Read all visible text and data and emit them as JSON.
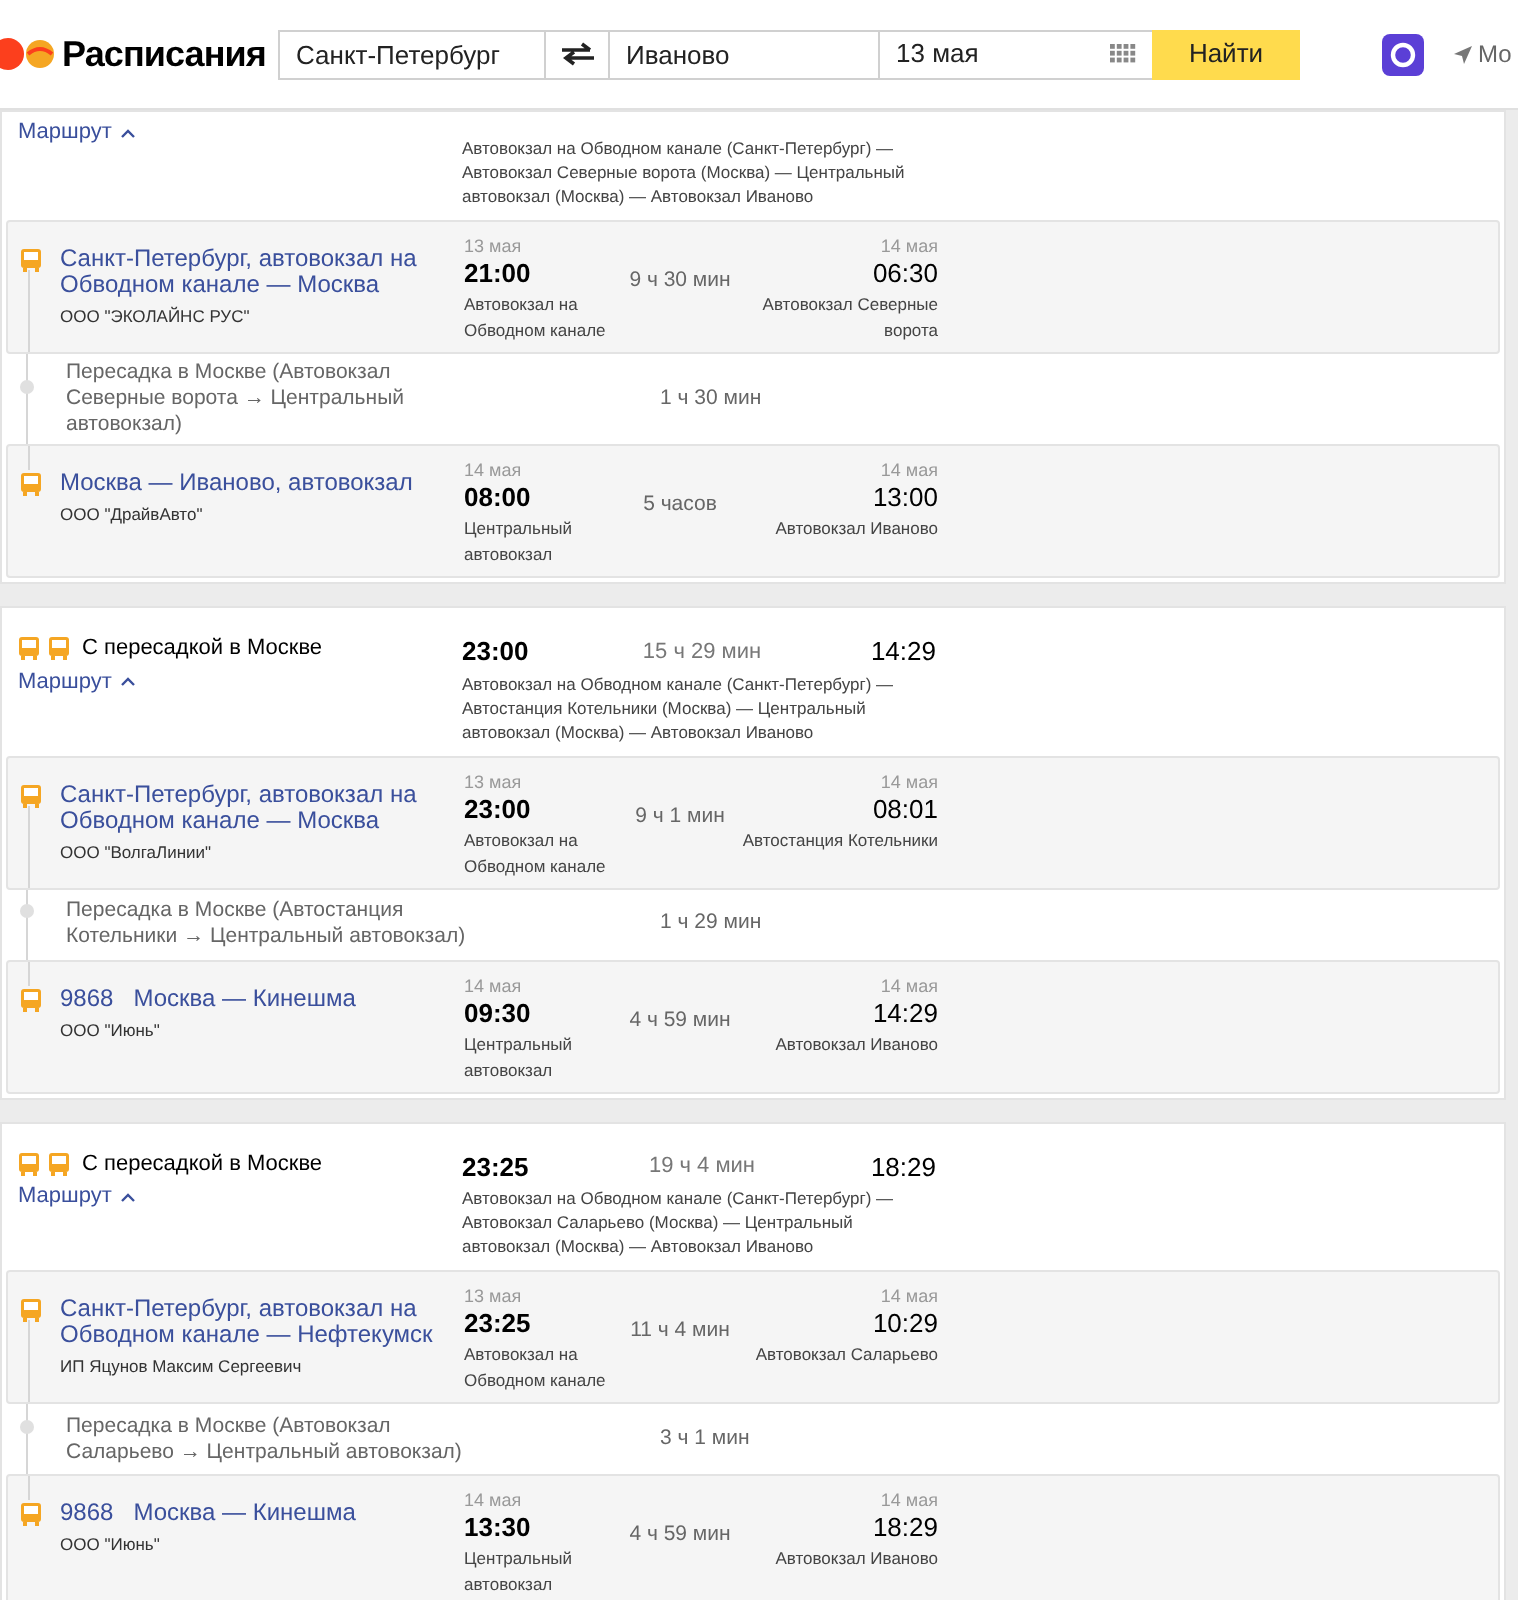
{
  "header": {
    "logo_text": "Расписания",
    "from": "Санкт-Петербург",
    "to": "Иваново",
    "date": "13 мая",
    "search_button": "Найти",
    "nav_text": "Мо"
  },
  "journeys": [
    {
      "route_link": "Маршрут",
      "expanded": true,
      "route_text": "Автовокзал на Обводном канале (Санкт-Петербург) — Автовокзал Северные ворота (Москва) — Центральный автовокзал (Москва) — Автовокзал Иваново",
      "segments": [
        {
          "kind": "trip",
          "title": "Санкт-Петербург, автовокзал на Обводном канале — Москва",
          "carrier": "ООО \"ЭКОЛАЙНС РУС\"",
          "dep_date": "13 мая",
          "dep_time": "21:00",
          "dep_station": "Автовокзал на Обводном канале",
          "duration": "9 ч 30 мин",
          "arr_date": "14 мая",
          "arr_time": "06:30",
          "arr_station": "Автовокзал Северные ворота"
        },
        {
          "kind": "transfer",
          "text": "Пересадка в Москве (Автовокзал Северные ворота → Центральный автовокзал)",
          "duration": "1 ч 30 мин"
        },
        {
          "kind": "trip",
          "title": "Москва — Иваново, автовокзал",
          "carrier": "ООО \"ДрайвАвто\"",
          "dep_date": "14 мая",
          "dep_time": "08:00",
          "dep_station": "Центральный автовокзал",
          "duration": "5 часов",
          "arr_date": "14 мая",
          "arr_time": "13:00",
          "arr_station": "Автовокзал Иваново"
        }
      ]
    },
    {
      "transports": [
        {
          "kind": "bus"
        },
        {
          "kind": "bus"
        }
      ],
      "title": "С пересадкой в Москве",
      "route_link": "Маршрут",
      "expanded": true,
      "dep_time": "23:00",
      "duration": "15 ч 29 мин",
      "arr_time": "14:29",
      "route_text": "Автовокзал на Обводном канале (Санкт-Петербург) — Автостанция Котельники (Москва) — Центральный автовокзал (Москва) — Автовокзал Иваново",
      "segments": [
        {
          "kind": "trip",
          "title": "Санкт-Петербург, автовокзал на Обводном канале — Москва",
          "carrier": "ООО \"ВолгаЛинии\"",
          "dep_date": "13 мая",
          "dep_time": "23:00",
          "dep_station": "Автовокзал на Обводном канале",
          "duration": "9 ч 1 мин",
          "arr_date": "14 мая",
          "arr_time": "08:01",
          "arr_station": "Автостанция Котельники"
        },
        {
          "kind": "transfer",
          "text": "Пересадка в Москве (Автостанция Котельники → Центральный автовокзал)",
          "duration": "1 ч 29 мин"
        },
        {
          "kind": "trip",
          "number": "9868",
          "title": "Москва — Кинешма",
          "carrier": "ООО \"Июнь\"",
          "dep_date": "14 мая",
          "dep_time": "09:30",
          "dep_station": "Центральный автовокзал",
          "duration": "4 ч 59 мин",
          "arr_date": "14 мая",
          "arr_time": "14:29",
          "arr_station": "Автовокзал Иваново"
        }
      ]
    },
    {
      "transports": [
        {
          "kind": "bus"
        },
        {
          "kind": "bus"
        }
      ],
      "title": "С пересадкой в Москве",
      "route_link": "Маршрут",
      "expanded": true,
      "dep_time": "23:25",
      "duration": "19 ч 4 мин",
      "arr_time": "18:29",
      "route_text": "Автовокзал на Обводном канале (Санкт-Петербург) — Автовокзал Саларьево (Москва) — Центральный автовокзал (Москва) — Автовокзал Иваново",
      "segments": [
        {
          "kind": "trip",
          "title": "Санкт-Петербург, автовокзал на Обводном канале — Нефтекумск",
          "carrier": "ИП Яцунов Максим Сергеевич",
          "dep_date": "13 мая",
          "dep_time": "23:25",
          "dep_station": "Автовокзал на Обводном канале",
          "duration": "11 ч 4 мин",
          "arr_date": "14 мая",
          "arr_time": "10:29",
          "arr_station": "Автовокзал Саларьево"
        },
        {
          "kind": "transfer",
          "text": "Пересадка в Москве (Автовокзал Саларьево → Центральный автовокзал)",
          "duration": "3 ч 1 мин"
        },
        {
          "kind": "trip",
          "number": "9868",
          "title": "Москва — Кинешма",
          "carrier": "ООО \"Июнь\"",
          "dep_date": "14 мая",
          "dep_time": "13:30",
          "dep_station": "Центральный автовокзал",
          "duration": "4 ч 59 мин",
          "arr_date": "14 мая",
          "arr_time": "18:29",
          "arr_station": "Автовокзал Иваново"
        }
      ]
    }
  ]
}
